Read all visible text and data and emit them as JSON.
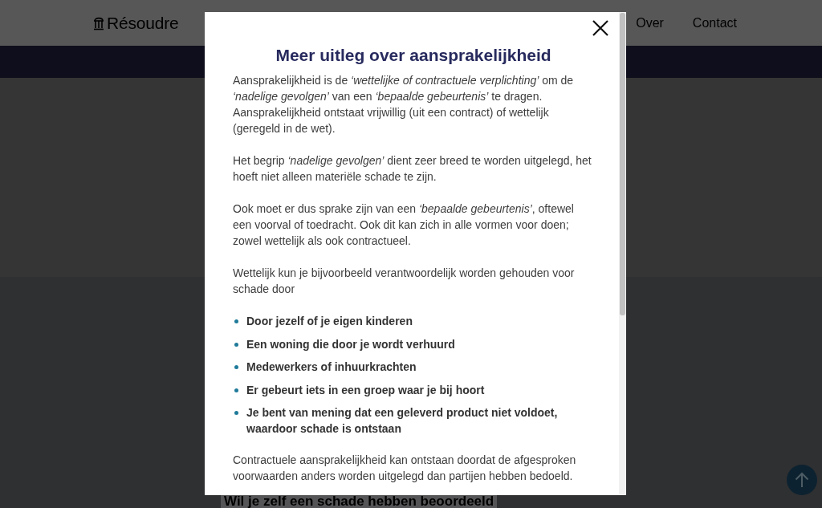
{
  "site_header": {
    "logo": "Résoudre",
    "nav": [
      "Over",
      "Contact"
    ]
  },
  "page": {
    "heading": "Wil je zelf een schade hebben beoordeeld"
  },
  "modal": {
    "title": "Meer uitleg over aansprakelijkheid",
    "blocks": [
      {
        "kind": "paragraph",
        "text": "Aansprakelijkheid is de *‘wettelijke of contractuele verplichting’* om de *‘nadelige gevolgen’* van een *‘bepaalde gebeurtenis’* te dragen. Aansprakelijkheid ontstaat vrijwillig (uit een contract) of wettelijk (geregeld in de wet)."
      },
      {
        "kind": "paragraph",
        "text": "Het begrip *‘nadelige gevolgen’* dient zeer breed te worden uitgelegd, het hoeft niet alleen materiële schade te zijn."
      },
      {
        "kind": "paragraph",
        "text": "Ook moet er dus sprake zijn van een *‘bepaalde gebeurtenis’*, oftewel een voorval of toedracht. Ook dit kan zich in alle vormen voor doen; zowel wettelijk als ook contractueel."
      },
      {
        "kind": "paragraph",
        "text": "Wettelijk kun je bijvoorbeeld verantwoordelijk worden gehouden voor schade door"
      },
      {
        "kind": "list",
        "items": [
          "Door jezelf of je eigen kinderen",
          "Een woning die door je wordt verhuurd",
          "Medewerkers of inhuurkrachten",
          "Er gebeurt iets in een groep waar je bij hoort",
          "Je bent van mening dat een geleverd product niet voldoet, waardoor schade is ontstaan"
        ]
      },
      {
        "kind": "paragraph",
        "text": "Contractuele aansprakelijkheid kan ontstaan doordat de afgesproken voorwaarden anders worden uitgelegd dan partijen hebben bedoeld."
      }
    ]
  }
}
